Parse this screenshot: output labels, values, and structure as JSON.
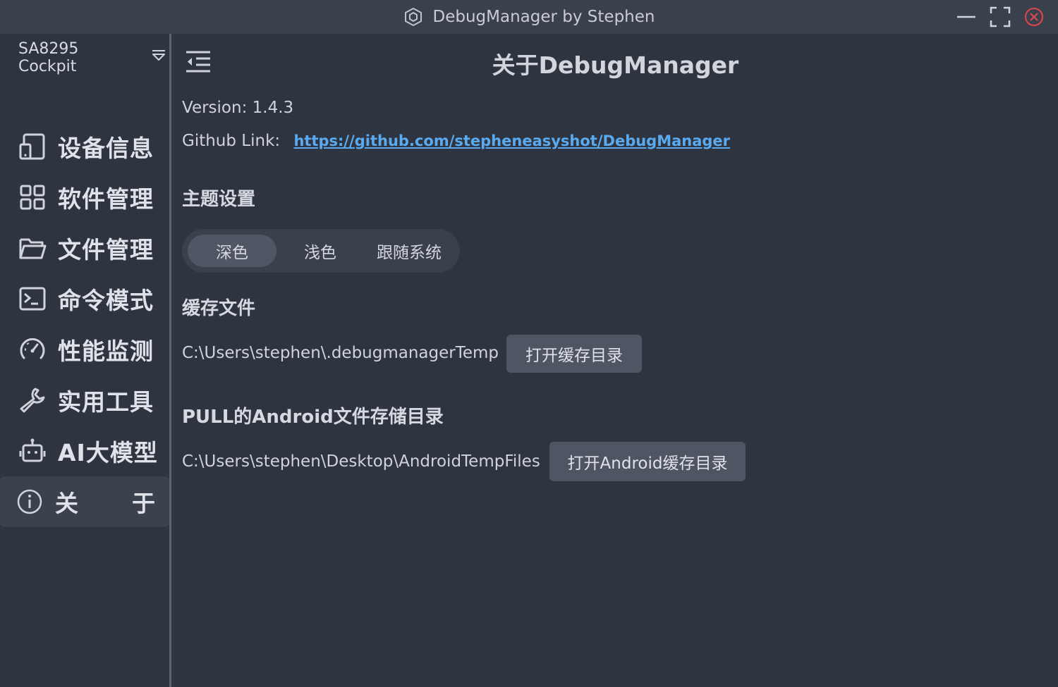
{
  "titlebar": {
    "title": "DebugManager by Stephen",
    "icons": [
      "app-logo-icon",
      "minimize-icon",
      "maximize-icon",
      "close-icon"
    ],
    "close_color": "#e0454b"
  },
  "sidebar": {
    "device": "SA8295 Cockpit",
    "items": [
      {
        "label": "设备信息",
        "icon": "device-icon"
      },
      {
        "label": "软件管理",
        "icon": "apps-grid-icon"
      },
      {
        "label": "文件管理",
        "icon": "folder-icon"
      },
      {
        "label": "命令模式",
        "icon": "terminal-icon"
      },
      {
        "label": "性能监测",
        "icon": "gauge-icon"
      },
      {
        "label": "实用工具",
        "icon": "wrench-icon"
      },
      {
        "label": "AI大模型",
        "icon": "robot-icon"
      },
      {
        "label_a": "关",
        "label_b": "于",
        "icon": "info-icon",
        "active": true
      }
    ]
  },
  "main": {
    "title": "关于DebugManager",
    "version_text": "Version: 1.4.3",
    "github_label": "Github Link:",
    "github_url": "https://github.com/stepheneasyshot/DebugManager",
    "theme": {
      "title": "主题设置",
      "options": [
        "深色",
        "浅色",
        "跟随系统"
      ],
      "selected": "深色"
    },
    "cache": {
      "title": "缓存文件",
      "path": "C:\\Users\\stephen\\.debugmanagerTemp",
      "button": "打开缓存目录"
    },
    "android": {
      "title": "PULL的Android文件存储目录",
      "path": "C:\\Users\\stephen\\Desktop\\AndroidTempFiles",
      "button": "打开Android缓存目录"
    }
  }
}
